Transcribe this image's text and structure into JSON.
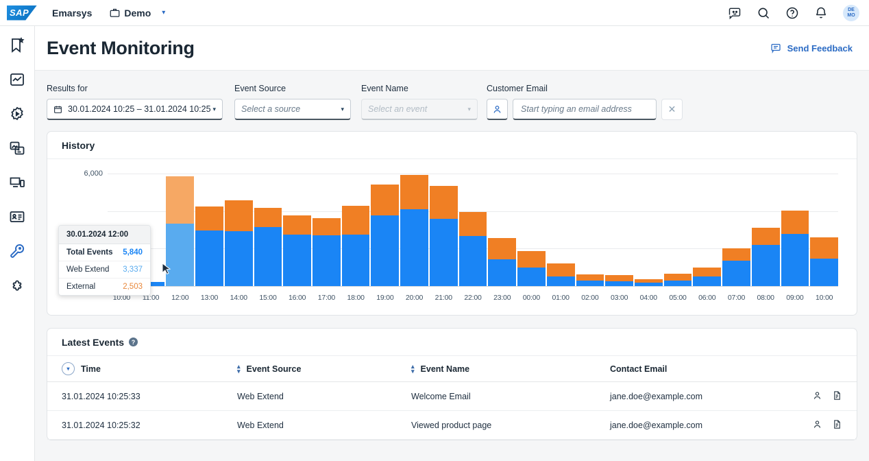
{
  "topbar": {
    "logo_text": "SAP",
    "brand": "Emarsys",
    "account": "Demo",
    "icons": [
      "feedback-smiley-icon",
      "search-icon",
      "help-icon",
      "bell-icon"
    ],
    "avatar_line1": "DE",
    "avatar_line2": "MO"
  },
  "sidebar": {
    "items": [
      {
        "name": "bookmark-star-icon",
        "active": false
      },
      {
        "name": "analytics-icon",
        "active": false
      },
      {
        "name": "automation-gear-icon",
        "active": false
      },
      {
        "name": "content-images-icon",
        "active": false
      },
      {
        "name": "channels-device-icon",
        "active": false
      },
      {
        "name": "contacts-card-icon",
        "active": false
      },
      {
        "name": "tools-wrench-icon",
        "active": true
      },
      {
        "name": "integrations-puzzle-icon",
        "active": false
      }
    ]
  },
  "page": {
    "title": "Event Monitoring",
    "feedback_label": "Send Feedback",
    "feedback_icon": "comment-icon"
  },
  "filters": {
    "results_for_label": "Results for",
    "date_range": "30.01.2024 10:25 – 31.01.2024 10:25",
    "date_icon": "calendar-icon",
    "event_source_label": "Event Source",
    "event_source_placeholder": "Select a source",
    "event_name_label": "Event Name",
    "event_name_placeholder": "Select an event",
    "customer_email_label": "Customer Email",
    "customer_email_placeholder": "Start typing an email address",
    "customer_email_value": "",
    "person_icon": "person-icon",
    "clear_icon": "close-icon"
  },
  "history": {
    "title": "History"
  },
  "chart_data": {
    "type": "bar",
    "stacked": true,
    "title": "History",
    "xlabel": "",
    "ylabel": "",
    "ylim": [
      0,
      6000
    ],
    "yticks": [
      0,
      6000
    ],
    "ytick_labels": [
      "0",
      "6,000"
    ],
    "gridlines": [
      0,
      2000,
      4000,
      6000
    ],
    "grid": true,
    "legend_position": "none",
    "categories": [
      "10:00",
      "11:00",
      "12:00",
      "13:00",
      "14:00",
      "15:00",
      "16:00",
      "17:00",
      "18:00",
      "19:00",
      "20:00",
      "21:00",
      "22:00",
      "23:00",
      "00:00",
      "01:00",
      "02:00",
      "03:00",
      "04:00",
      "05:00",
      "06:00",
      "07:00",
      "08:00",
      "09:00",
      "10:00"
    ],
    "series": [
      {
        "name": "Web Extend",
        "color": "#1a85f5",
        "values": [
          200,
          210,
          3337,
          2950,
          2930,
          3130,
          2760,
          2700,
          2740,
          3760,
          4080,
          3570,
          2680,
          1440,
          1000,
          520,
          290,
          250,
          180,
          300,
          520,
          1360,
          2180,
          2780,
          1480
        ]
      },
      {
        "name": "External",
        "color": "#f07f24",
        "values": [
          0,
          0,
          2503,
          1280,
          1640,
          1040,
          1010,
          940,
          1540,
          1640,
          1840,
          1790,
          1280,
          1120,
          870,
          680,
          330,
          330,
          190,
          350,
          480,
          640,
          940,
          1260,
          1100
        ]
      }
    ],
    "totals": [
      200,
      210,
      5840,
      4230,
      4570,
      4170,
      3770,
      3640,
      4280,
      5400,
      5920,
      5360,
      3960,
      2560,
      1870,
      1200,
      620,
      580,
      370,
      650,
      1000,
      2000,
      3120,
      4040,
      2580
    ],
    "highlighted_category": "12:00"
  },
  "tooltip": {
    "timestamp": "30.01.2024 12:00",
    "rows": [
      {
        "label": "Total Events",
        "value": "5,840"
      },
      {
        "label": "Web Extend",
        "value": "3,337"
      },
      {
        "label": "External",
        "value": "2,503"
      }
    ]
  },
  "latest_events": {
    "title": "Latest Events",
    "help_icon": "help-circle-icon",
    "columns": [
      {
        "label": "Time",
        "sort": "active-desc"
      },
      {
        "label": "Event Source",
        "sort": "sortable"
      },
      {
        "label": "Event Name",
        "sort": "sortable"
      },
      {
        "label": "Contact Email",
        "sort": "none"
      }
    ],
    "rows": [
      {
        "time": "31.01.2024 10:25:33",
        "source": "Web Extend",
        "event": "Welcome Email",
        "email": "jane.doe@example.com",
        "icons": [
          "person-icon",
          "document-icon"
        ]
      },
      {
        "time": "31.01.2024 10:25:32",
        "source": "Web Extend",
        "event": "Viewed product page",
        "email": "jane.doe@example.com",
        "icons": [
          "person-icon",
          "document-icon"
        ]
      }
    ]
  },
  "colors": {
    "accent": "#2b6bc4",
    "web_extend": "#1a85f5",
    "external": "#f07f24",
    "web_extend_highlight": "#59abef",
    "external_highlight": "#f6a864"
  }
}
